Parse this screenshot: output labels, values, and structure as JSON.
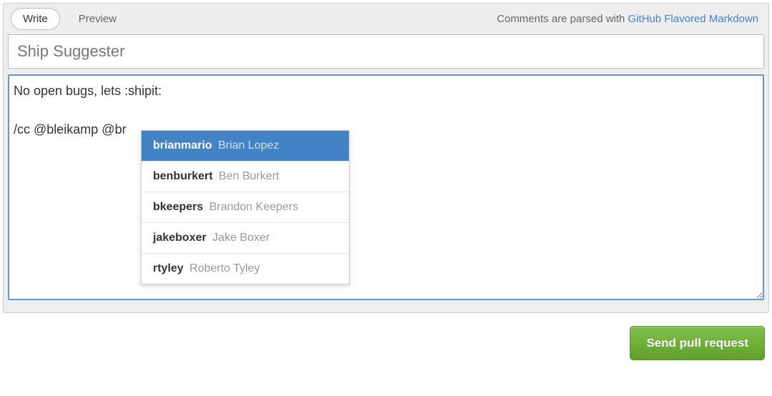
{
  "tabs": {
    "write": "Write",
    "preview": "Preview"
  },
  "hint": {
    "prefix": "Comments are parsed with ",
    "link_text": "GitHub Flavored Markdown"
  },
  "title": {
    "value": "Ship Suggester"
  },
  "body": {
    "value": "No open bugs, lets :shipit:\n\n/cc @bleikamp @br"
  },
  "autocomplete": {
    "items": [
      {
        "username": "brianmario",
        "fullname": "Brian Lopez",
        "selected": true
      },
      {
        "username": "benburkert",
        "fullname": "Ben Burkert",
        "selected": false
      },
      {
        "username": "bkeepers",
        "fullname": "Brandon Keepers",
        "selected": false
      },
      {
        "username": "jakeboxer",
        "fullname": "Jake Boxer",
        "selected": false
      },
      {
        "username": "rtyley",
        "fullname": "Roberto Tyley",
        "selected": false
      }
    ]
  },
  "submit": {
    "label": "Send pull request"
  }
}
